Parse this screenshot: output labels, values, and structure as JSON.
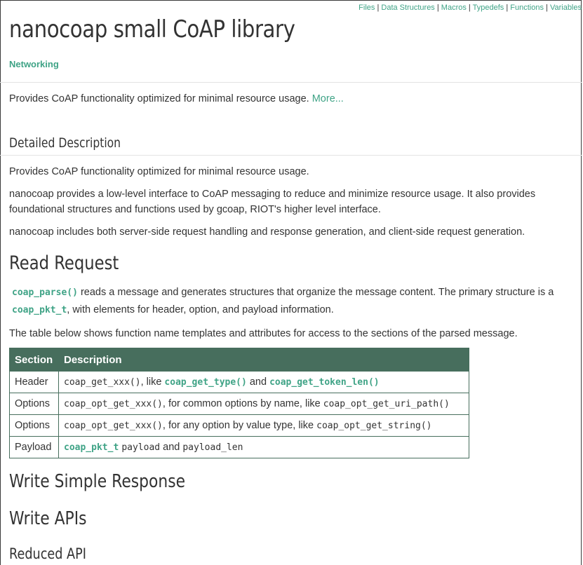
{
  "nav": {
    "links": [
      "Files",
      "Data Structures",
      "Macros",
      "Typedefs",
      "Functions",
      "Variables"
    ],
    "separator": " | "
  },
  "header": {
    "title": "nanocoap small CoAP library",
    "group_link": "Networking"
  },
  "brief": {
    "text": "Provides CoAP functionality optimized for minimal resource usage.",
    "more_link": "More..."
  },
  "detailed": {
    "heading": "Detailed Description",
    "p1": "Provides CoAP functionality optimized for minimal resource usage.",
    "p2": "nanocoap provides a low-level interface to CoAP messaging to reduce and minimize resource usage. It also provides foundational structures and functions used by gcoap, RIOT's higher level interface.",
    "p3": "nanocoap includes both server-side request handling and response generation, and client-side request generation."
  },
  "read_request": {
    "heading": "Read Request",
    "p1_link1": "coap_parse()",
    "p1_text1": " reads a message and generates structures that organize the message content. The primary structure is a",
    "p1_link2": "coap_pkt_t",
    "p1_text2": ", with elements for header, option, and payload information.",
    "p2": "The table below shows function name templates and attributes for access to the sections of the parsed message."
  },
  "table": {
    "headers": [
      "Section",
      "Description"
    ],
    "rows": [
      {
        "section": "Header",
        "parts": [
          {
            "t": "code",
            "v": "coap_get_xxx()"
          },
          {
            "t": "text",
            "v": ", like "
          },
          {
            "t": "link",
            "v": "coap_get_type()"
          },
          {
            "t": "text",
            "v": " and "
          },
          {
            "t": "link",
            "v": "coap_get_token_len()"
          }
        ]
      },
      {
        "section": "Options",
        "parts": [
          {
            "t": "code",
            "v": "coap_opt_get_xxx()"
          },
          {
            "t": "text",
            "v": ", for common options by name, like "
          },
          {
            "t": "code",
            "v": "coap_opt_get_uri_path()"
          }
        ]
      },
      {
        "section": "Options",
        "parts": [
          {
            "t": "code",
            "v": "coap_opt_get_xxx()"
          },
          {
            "t": "text",
            "v": ", for any option by value type, like "
          },
          {
            "t": "code",
            "v": "coap_opt_get_string()"
          }
        ]
      },
      {
        "section": "Payload",
        "parts": [
          {
            "t": "link",
            "v": "coap_pkt_t"
          },
          {
            "t": "text",
            "v": " "
          },
          {
            "t": "code",
            "v": "payload"
          },
          {
            "t": "text",
            "v": " and "
          },
          {
            "t": "code",
            "v": "payload_len"
          }
        ]
      }
    ]
  },
  "sections": {
    "write_simple": "Write Simple Response",
    "write_apis": "Write APIs",
    "reduced_api": "Reduced API"
  },
  "colors": {
    "link": "#3fa386",
    "table_header": "#476e5d"
  }
}
